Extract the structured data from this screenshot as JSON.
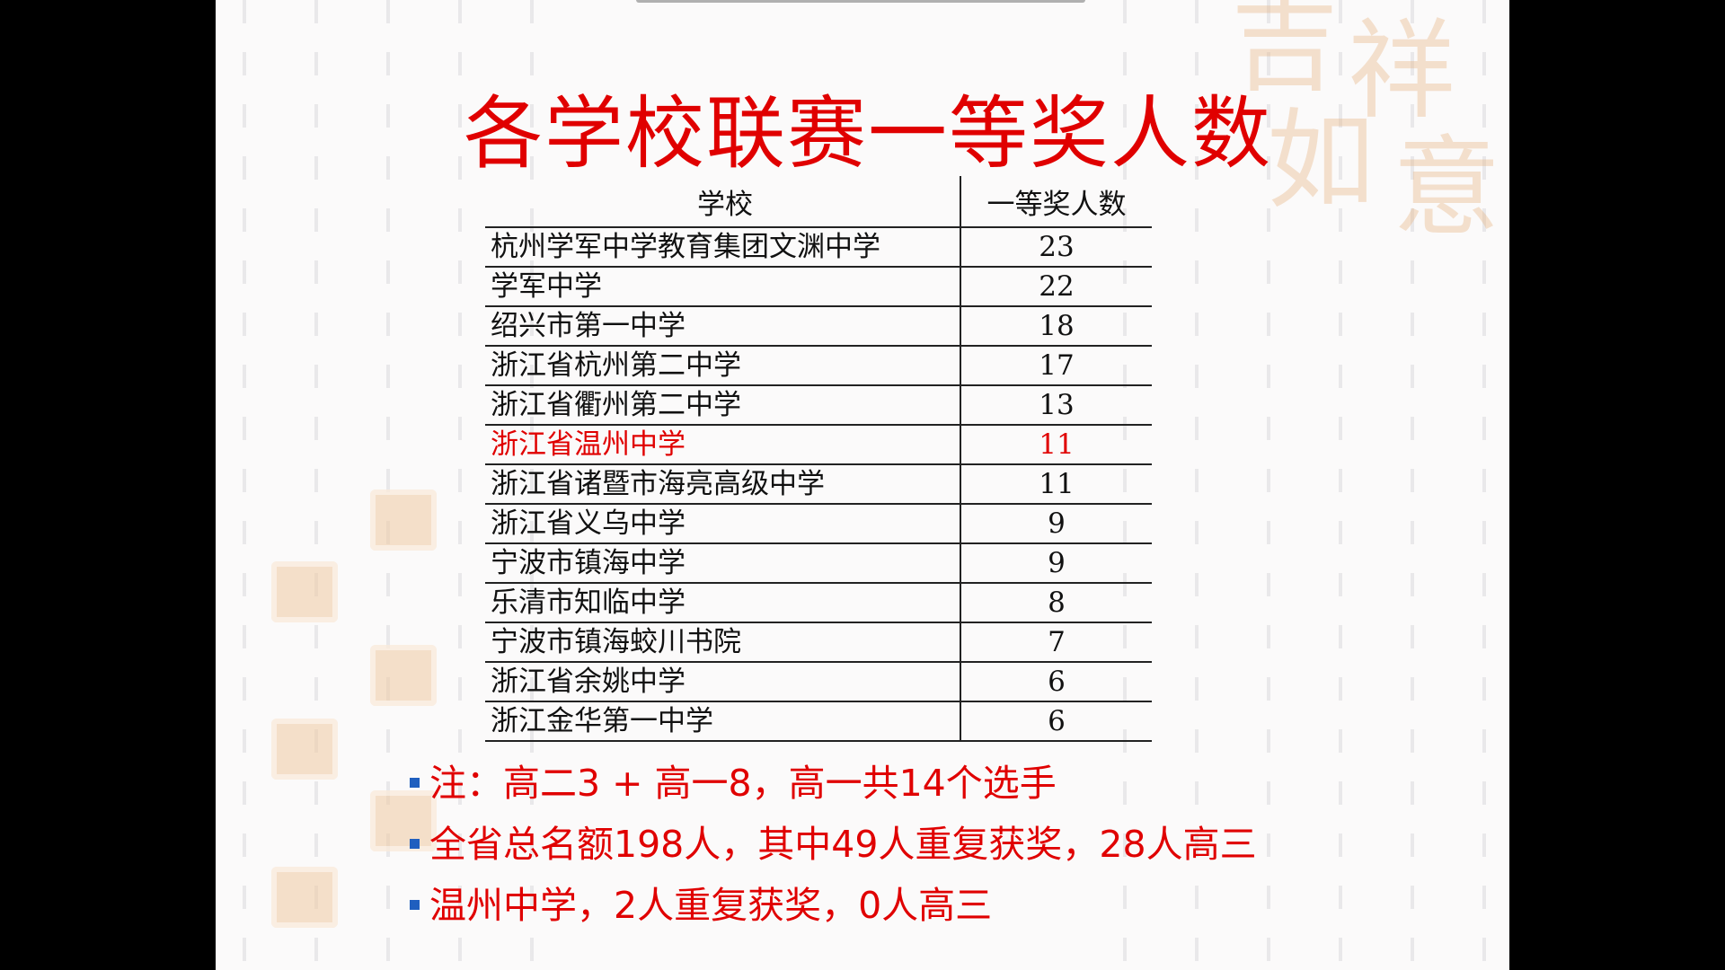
{
  "slide": {
    "title": "各学校联赛一等奖人数",
    "table": {
      "headers": [
        "学校",
        "一等奖人数"
      ],
      "rows": [
        {
          "school": "杭州学军中学教育集团文渊中学",
          "count": "23",
          "highlight": false
        },
        {
          "school": "学军中学",
          "count": "22",
          "highlight": false
        },
        {
          "school": "绍兴市第一中学",
          "count": "18",
          "highlight": false
        },
        {
          "school": "浙江省杭州第二中学",
          "count": "17",
          "highlight": false
        },
        {
          "school": "浙江省衢州第二中学",
          "count": "13",
          "highlight": false
        },
        {
          "school": "浙江省温州中学",
          "count": "11",
          "highlight": true
        },
        {
          "school": "浙江省诸暨市海亮高级中学",
          "count": "11",
          "highlight": false
        },
        {
          "school": "浙江省义乌中学",
          "count": "9",
          "highlight": false
        },
        {
          "school": "宁波市镇海中学",
          "count": "9",
          "highlight": false
        },
        {
          "school": "乐清市知临中学",
          "count": "8",
          "highlight": false
        },
        {
          "school": "宁波市镇海蛟川书院",
          "count": "7",
          "highlight": false
        },
        {
          "school": "浙江省余姚中学",
          "count": "6",
          "highlight": false
        },
        {
          "school": "浙江金华第一中学",
          "count": "6",
          "highlight": false
        }
      ]
    },
    "notes": [
      "注：高二3 + 高一8，高一共14个选手",
      "全省总名额198人，其中49人重复获奖，28人高三",
      "温州中学，2人重复获奖，0人高三"
    ],
    "colors": {
      "title": "#e00000",
      "highlight": "#e00000",
      "bullet": "#1f5fbf",
      "background": "#fbfafa"
    }
  }
}
